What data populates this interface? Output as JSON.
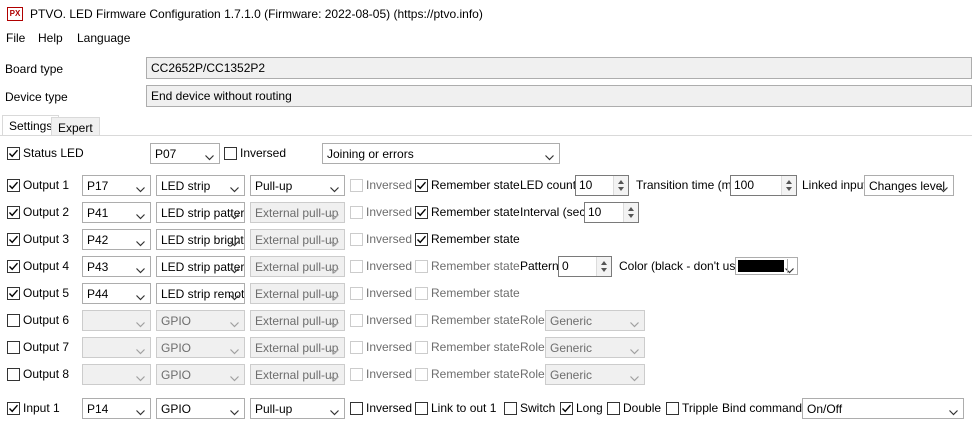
{
  "window": {
    "title": "PTVO. LED Firmware Configuration 1.7.1.0 (Firmware: 2022-08-05) (https://ptvo.info)",
    "app_icon_text": "PX"
  },
  "menu": [
    "File",
    "Help",
    "Language"
  ],
  "board_type": {
    "label": "Board type",
    "value": "CC2652P/CC1352P2"
  },
  "device_type": {
    "label": "Device type",
    "value": "End device without routing"
  },
  "tabs": [
    {
      "label": "Settings",
      "active": true
    },
    {
      "label": "Expert",
      "active": false
    }
  ],
  "status_led": {
    "label": "Status LED",
    "checked": true,
    "pin": "P07",
    "inversed_label": "Inversed",
    "inversed": false,
    "mode": "Joining or errors"
  },
  "common_labels": {
    "inversed": "Inversed",
    "remember_state": "Remember state",
    "role": "Role"
  },
  "outputs": [
    {
      "label": "Output 1",
      "checked": true,
      "pin": "P17",
      "type": "LED strip",
      "pull": "Pull-up",
      "pull_enabled": true,
      "inversed": false,
      "remember": true,
      "remember_enabled": true,
      "extra": {
        "led_count_label": "LED count",
        "led_count": "10",
        "transition_label": "Transition time (ms)",
        "transition": "100",
        "linked_label": "Linked input",
        "linked": "Changes level"
      }
    },
    {
      "label": "Output 2",
      "checked": true,
      "pin": "P41",
      "type": "LED strip pattern",
      "pull": "External pull-up",
      "pull_enabled": false,
      "inversed": false,
      "remember": true,
      "remember_enabled": true,
      "extra": {
        "interval_label": "Interval (sec)",
        "interval": "10"
      }
    },
    {
      "label": "Output 3",
      "checked": true,
      "pin": "P42",
      "type": "LED strip brightness",
      "pull": "External pull-up",
      "pull_enabled": false,
      "inversed": false,
      "remember": true,
      "remember_enabled": true
    },
    {
      "label": "Output 4",
      "checked": true,
      "pin": "P43",
      "type": "LED strip pattern",
      "pull": "External pull-up",
      "pull_enabled": false,
      "inversed": false,
      "remember": false,
      "remember_enabled": false,
      "extra": {
        "pattern_label": "Pattern",
        "pattern": "0",
        "color_label": "Color (black - don't use)",
        "color": "#000000"
      }
    },
    {
      "label": "Output 5",
      "checked": true,
      "pin": "P44",
      "type": "LED strip remote",
      "pull": "External pull-up",
      "pull_enabled": false,
      "inversed": false,
      "remember": false,
      "remember_enabled": false
    },
    {
      "label": "Output 6",
      "checked": false,
      "pin": "",
      "type": "GPIO",
      "pull": "External pull-up",
      "pull_enabled": false,
      "inversed": false,
      "remember": false,
      "remember_enabled": false,
      "role": "Generic"
    },
    {
      "label": "Output 7",
      "checked": false,
      "pin": "",
      "type": "GPIO",
      "pull": "External pull-up",
      "pull_enabled": false,
      "inversed": false,
      "remember": false,
      "remember_enabled": false,
      "role": "Generic"
    },
    {
      "label": "Output 8",
      "checked": false,
      "pin": "",
      "type": "GPIO",
      "pull": "External pull-up",
      "pull_enabled": false,
      "inversed": false,
      "remember": false,
      "remember_enabled": false,
      "role": "Generic"
    }
  ],
  "input1": {
    "label": "Input 1",
    "checked": true,
    "pin": "P14",
    "type": "GPIO",
    "pull": "Pull-up",
    "inversed_label": "Inversed",
    "inversed": false,
    "link_label": "Link to out 1",
    "link": false,
    "switch_label": "Switch",
    "switch": false,
    "long_label": "Long",
    "long": true,
    "double_label": "Double",
    "double": false,
    "tripple_label": "Tripple",
    "tripple": false,
    "bind_label": "Bind command",
    "bind": "On/Off"
  }
}
